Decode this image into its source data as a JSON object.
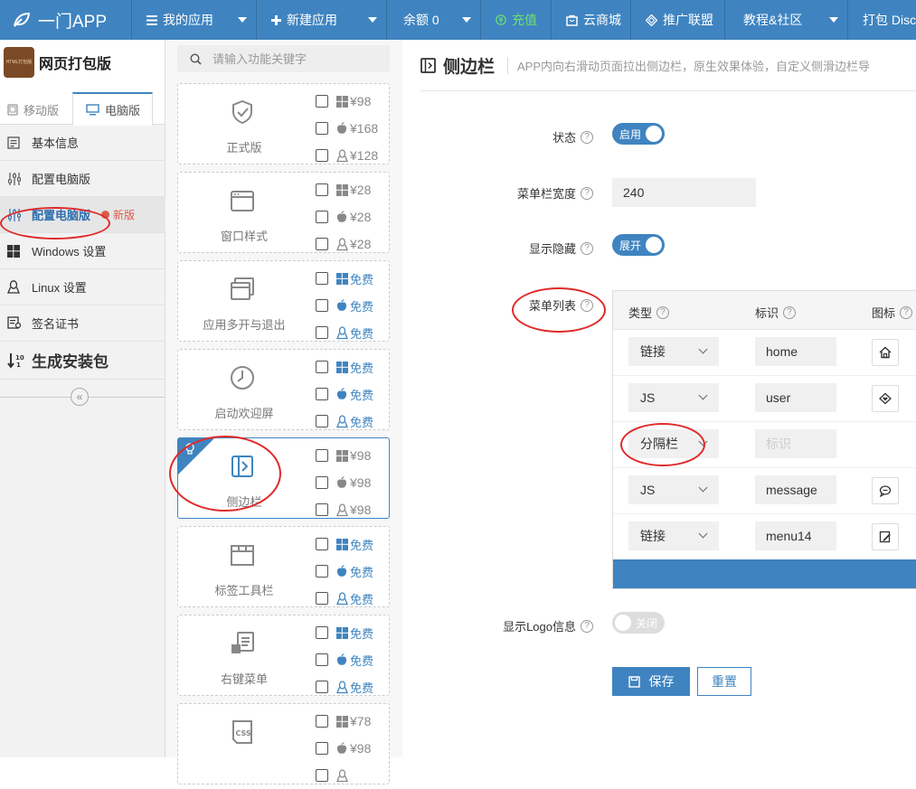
{
  "topbar": {
    "brand": "一门APP",
    "items": [
      {
        "label": "我的应用",
        "icon": "list-icon"
      },
      {
        "label": "新建应用",
        "icon": "plus-icon"
      },
      {
        "label": "余额 0",
        "icon": ""
      },
      {
        "label": "充值",
        "icon": "yuan-icon"
      },
      {
        "label": "云商城",
        "icon": "shop-icon"
      },
      {
        "label": "推广联盟",
        "icon": "diamond-icon"
      },
      {
        "label": "教程&社区",
        "icon": ""
      },
      {
        "label": "打包 Disc",
        "icon": ""
      }
    ],
    "colors": {
      "bar": "#3f84c0",
      "recharge": "#6ee06e"
    }
  },
  "sidebar": {
    "app_logo_text": "HTML打包版",
    "app_name": "网页打包版",
    "version_tabs": [
      {
        "label": "移动版",
        "icon": "mobile-icon",
        "active": false
      },
      {
        "label": "电脑版",
        "icon": "monitor-icon",
        "active": true
      }
    ],
    "menu": [
      {
        "label": "基本信息",
        "icon": "info-icon"
      },
      {
        "label": "配置电脑版",
        "icon": "sliders-icon"
      },
      {
        "label": "配置电脑版",
        "icon": "sliders-icon",
        "active": true,
        "badge": "新版"
      },
      {
        "label": "Windows 设置",
        "icon": "windows-icon"
      },
      {
        "label": "Linux 设置",
        "icon": "linux-icon"
      },
      {
        "label": "签名证书",
        "icon": "certificate-icon"
      },
      {
        "label": "生成安装包",
        "icon": "sort-numeric-icon"
      }
    ],
    "collapse_icon": "double-chevron-left-icon"
  },
  "features": {
    "search_placeholder": "请输入功能关键字",
    "cards": [
      {
        "name": "正式版",
        "icon": "shield-check-icon",
        "prices": [
          "¥98",
          "¥168",
          "¥128"
        ]
      },
      {
        "name": "窗口样式",
        "icon": "window-icon",
        "prices": [
          "¥28",
          "¥28",
          "¥28"
        ]
      },
      {
        "name": "应用多开与退出",
        "icon": "multi-window-icon",
        "prices": [
          "免费",
          "免费",
          "免费"
        ]
      },
      {
        "name": "启动欢迎屏",
        "icon": "clock-icon",
        "prices": [
          "免费",
          "免费",
          "免费"
        ]
      },
      {
        "name": "侧边栏",
        "icon": "sidebar-icon",
        "prices": [
          "¥98",
          "¥98",
          "¥98"
        ],
        "selected": true
      },
      {
        "name": "标签工具栏",
        "icon": "tabs-icon",
        "prices": [
          "免费",
          "免费",
          "免费"
        ]
      },
      {
        "name": "右键菜单",
        "icon": "context-menu-icon",
        "prices": [
          "免费",
          "免费",
          "免费"
        ]
      },
      {
        "name": "",
        "icon": "css-icon",
        "prices": [
          "¥78",
          "¥98",
          ""
        ]
      }
    ],
    "platform_icons": [
      "windows-icon",
      "apple-icon",
      "linux-icon"
    ]
  },
  "main": {
    "title": "侧边栏",
    "description": "APP内向右滑动页面拉出侧边栏，原生效果体验，自定义侧滑边栏导",
    "fields": {
      "status": {
        "label": "状态",
        "toggle": "启用",
        "on": true
      },
      "width": {
        "label": "菜单栏宽度",
        "value": "240"
      },
      "show_hide": {
        "label": "显示隐藏",
        "toggle": "展开",
        "on": true
      },
      "menu_list": {
        "label": "菜单列表"
      },
      "show_logo": {
        "label": "显示Logo信息",
        "toggle": "关闭",
        "on": false
      }
    },
    "table": {
      "headers": [
        "类型",
        "标识",
        "图标"
      ],
      "rows": [
        {
          "type": "链接",
          "tag": "home",
          "placeholder": "",
          "icon": "home-icon"
        },
        {
          "type": "JS",
          "tag": "user",
          "placeholder": "",
          "icon": "tag-heart-icon"
        },
        {
          "type": "分隔栏",
          "tag": "",
          "placeholder": "标识",
          "icon": ""
        },
        {
          "type": "JS",
          "tag": "message",
          "placeholder": "",
          "icon": "chat-icon"
        },
        {
          "type": "链接",
          "tag": "menu14",
          "placeholder": "",
          "icon": "edit-note-icon"
        }
      ]
    },
    "buttons": {
      "save": "保存",
      "reset": "重置"
    },
    "colors": {
      "primary": "#3f84c0",
      "annotation": "#e02a2a"
    }
  }
}
